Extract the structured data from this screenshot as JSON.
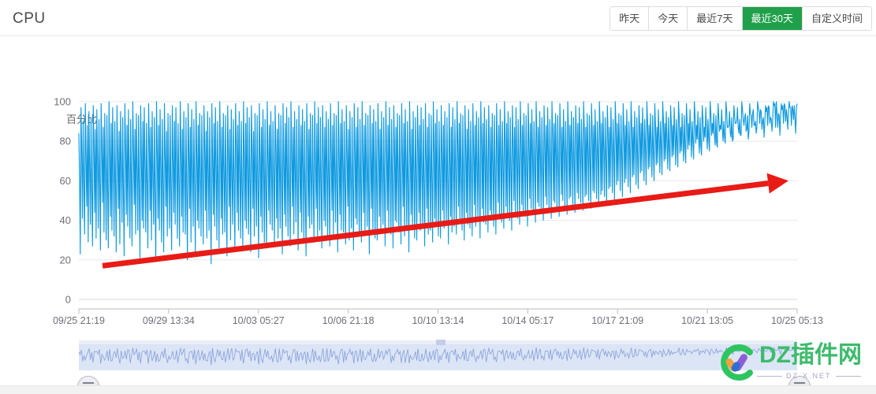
{
  "header": {
    "title": "CPU",
    "range_buttons": [
      {
        "label": "昨天",
        "active": false
      },
      {
        "label": "今天",
        "active": false
      },
      {
        "label": "最近7天",
        "active": false
      },
      {
        "label": "最近30天",
        "active": true
      },
      {
        "label": "自定义时间",
        "active": false
      }
    ]
  },
  "watermark": {
    "brand": "DZ插件网",
    "domain": "DZ-X.NET",
    "icon": "dz-logo-icon"
  },
  "slider": {
    "left_handle_icon": "slider-handle-icon",
    "right_handle_icon": "slider-handle-icon",
    "grip_icon": "slider-grip-icon"
  },
  "annotation": {
    "trend_arrow_color": "#e81b16",
    "trend_arrow_label": "upward-trend-arrow"
  },
  "colors": {
    "series": "#0f9ae0",
    "accent_green": "#20a04a",
    "grid": "#e8e8e8",
    "axis_text": "#6e7079",
    "slider_fill": "#d6e0f5",
    "slider_line": "#7e9ad8"
  },
  "chart_data": {
    "type": "line",
    "title": "CPU",
    "xlabel": "",
    "ylabel": "百分比",
    "ylim": [
      0,
      100
    ],
    "yticks": [
      0,
      20,
      40,
      60,
      80,
      100
    ],
    "grid": true,
    "legend": "none",
    "xticks": [
      "09/25 21:19",
      "09/29 13:34",
      "10/03 05:27",
      "10/06 21:18",
      "10/10 13:14",
      "10/14 05:17",
      "10/17 21:09",
      "10/21 13:05",
      "10/25 05:13"
    ],
    "series": [
      {
        "name": "CPU",
        "color": "#0f9ae0",
        "description": "Dense high-frequency CPU utilisation samples over 30 days, oscillating between roughly 5% and 100%, with a rising baseline over time.",
        "baseline_trend": {
          "start_pct": 17,
          "end_pct": 60
        },
        "values": [
          84,
          62,
          23,
          97,
          75,
          41,
          90,
          58,
          33,
          99,
          71,
          47,
          88,
          29,
          95,
          66,
          38,
          92,
          55,
          27,
          98,
          79,
          44,
          86,
          31,
          96,
          69,
          36,
          91,
          60,
          25,
          99,
          77,
          49,
          87,
          34,
          94,
          64,
          30,
          93,
          57,
          26,
          100,
          73,
          42,
          89,
          35,
          97,
          67,
          32,
          90,
          59,
          24,
          98,
          74,
          46,
          85,
          28,
          95,
          70,
          39,
          92,
          54,
          22,
          99,
          78,
          43,
          88,
          37,
          96,
          63,
          31,
          91,
          61,
          27,
          100,
          76,
          48,
          86,
          33,
          94,
          65,
          35,
          93,
          56,
          21,
          98,
          72,
          40,
          90,
          36,
          97,
          68,
          34,
          89,
          58,
          26,
          99,
          80,
          45,
          87,
          30,
          95,
          62,
          38,
          92,
          53,
          19,
          100,
          75,
          41,
          88,
          35,
          96,
          66,
          29,
          91,
          59,
          24,
          99,
          73,
          47,
          85,
          32,
          94,
          64,
          36,
          93,
          57,
          25,
          98,
          71,
          44,
          90,
          38,
          97,
          69,
          31,
          89,
          60,
          27,
          100,
          76,
          42,
          86,
          34,
          95,
          63,
          33,
          92,
          55,
          20,
          99,
          74,
          46,
          87,
          29,
          96,
          67,
          37,
          91,
          58,
          23,
          100,
          72,
          40,
          88,
          36,
          94,
          65,
          32,
          93,
          61,
          28,
          98,
          77,
          45,
          85,
          31,
          95,
          66,
          35,
          92,
          54,
          18,
          99,
          70,
          43,
          89,
          37,
          97,
          68,
          30,
          90,
          59,
          26,
          100,
          75,
          41,
          87,
          33,
          94,
          64,
          34,
          93,
          56,
          22,
          98,
          73,
          47,
          86,
          30,
          96,
          62,
          38,
          91,
          60,
          25,
          99,
          78,
          44,
          88,
          35,
          95,
          67,
          31,
          90,
          57,
          27,
          100,
          71,
          40,
          89,
          36,
          97,
          65,
          33,
          92,
          61,
          24,
          98,
          76,
          46,
          85,
          32,
          94,
          63,
          37,
          93,
          58,
          21,
          99,
          72,
          42,
          87,
          34,
          96,
          68,
          29,
          91,
          55,
          26,
          100,
          74,
          45,
          88,
          38,
          95,
          66,
          35,
          90,
          62,
          28,
          98,
          77,
          41,
          86,
          31,
          94,
          69,
          36,
          93,
          59,
          23,
          99,
          70,
          43,
          89,
          37,
          97,
          64,
          32,
          92,
          57,
          27,
          100,
          75,
          47,
          87,
          33,
          95,
          65,
          39,
          91,
          61,
          25,
          98,
          73,
          44,
          88,
          34,
          96,
          67,
          30,
          90,
          56,
          22,
          99,
          78,
          42,
          86,
          36,
          94,
          63,
          38,
          93,
          60,
          29,
          100,
          71,
          46,
          89,
          32,
          97,
          68,
          35,
          92,
          58,
          26,
          98,
          74,
          40,
          87,
          37,
          95,
          66,
          31,
          91,
          62,
          27,
          99,
          76,
          45,
          88,
          33,
          94,
          64,
          39,
          93,
          57,
          24,
          100,
          72,
          43,
          89,
          35,
          96,
          69,
          34,
          90,
          60,
          28,
          98,
          75,
          47,
          86,
          30,
          95,
          63,
          36,
          92,
          59,
          25,
          99,
          77,
          41,
          87,
          38,
          97,
          65,
          32,
          91,
          61,
          29,
          100,
          73,
          44,
          88,
          34,
          94,
          67,
          37,
          93,
          56,
          23,
          98,
          70,
          46,
          89,
          33,
          96,
          66,
          31,
          90,
          63,
          30,
          99,
          79,
          42,
          86,
          36,
          95,
          64,
          38,
          92,
          58,
          27,
          100,
          74,
          45,
          88,
          35,
          97,
          68,
          33,
          91,
          62,
          26,
          98,
          76,
          40,
          87,
          39,
          94,
          65,
          34,
          93,
          60,
          28,
          99,
          71,
          47,
          89,
          32,
          96,
          69,
          36,
          90,
          57,
          24,
          100,
          75,
          43,
          86,
          37,
          95,
          63,
          31,
          92,
          64,
          30,
          98,
          78,
          44,
          88,
          35,
          97,
          66,
          38,
          91,
          59,
          27,
          99,
          72,
          46,
          87,
          33,
          94,
          68,
          35,
          93,
          61,
          29,
          100,
          77,
          41,
          89,
          38,
          96,
          65,
          32,
          90,
          63,
          31,
          98,
          74,
          45,
          88,
          36,
          95,
          67,
          39,
          92,
          60,
          28,
          99,
          73,
          42,
          87,
          34,
          97,
          69,
          37,
          91,
          66,
          33,
          100,
          79,
          47,
          89,
          40,
          94,
          64,
          35,
          93,
          62,
          30,
          98,
          76,
          44,
          86,
          38,
          96,
          70,
          36,
          90,
          65,
          32,
          99,
          75,
          48,
          88,
          37,
          95,
          68,
          41,
          92,
          63,
          31,
          100,
          80,
          46,
          89,
          39,
          97,
          71,
          38,
          91,
          67,
          34,
          98,
          77,
          45,
          87,
          40,
          94,
          69,
          37,
          93,
          64,
          33,
          99,
          78,
          49,
          88,
          42,
          96,
          72,
          39,
          90,
          68,
          36,
          100,
          81,
          47,
          89,
          43,
          95,
          70,
          40,
          92,
          66,
          35,
          98,
          79,
          50,
          87,
          44,
          97,
          73,
          41,
          91,
          69,
          38,
          100,
          82,
          48,
          88,
          45,
          94,
          71,
          42,
          93,
          67,
          37,
          99,
          80,
          51,
          89,
          46,
          96,
          74,
          43,
          90,
          70,
          39,
          100,
          83,
          49,
          87,
          47,
          95,
          72,
          44,
          92,
          68,
          40,
          98,
          81,
          52,
          88,
          48,
          97,
          75,
          45,
          91,
          71,
          41,
          100,
          84,
          50,
          89,
          49,
          94,
          73,
          46,
          93,
          69,
          42,
          99,
          82,
          53,
          87,
          50,
          96,
          76,
          47,
          90,
          72,
          43,
          100,
          85,
          51,
          88,
          52,
          95,
          74,
          48,
          92,
          70,
          44,
          98,
          83,
          54,
          89,
          51,
          97,
          77,
          49,
          91,
          73,
          45,
          100,
          86,
          52,
          87,
          53,
          94,
          75,
          50,
          93,
          71,
          46,
          99,
          84,
          55,
          88,
          54,
          96,
          78,
          51,
          90,
          74,
          47,
          100,
          87,
          53,
          89,
          55,
          95,
          76,
          52,
          92,
          72,
          48,
          98,
          85,
          56,
          87,
          57,
          97,
          79,
          54,
          91,
          75,
          50,
          100,
          88,
          58,
          89,
          60,
          94,
          77,
          55,
          93,
          73,
          52,
          99,
          86,
          59,
          88,
          61,
          96,
          80,
          57,
          90,
          76,
          54,
          100,
          89,
          62,
          87,
          63,
          95,
          78,
          58,
          92,
          74,
          56,
          98,
          87,
          64,
          89,
          65,
          97,
          81,
          60,
          91,
          77,
          58,
          100,
          90,
          66,
          88,
          67,
          94,
          79,
          62,
          93,
          75,
          60,
          99,
          88,
          68,
          87,
          69,
          96,
          82,
          64,
          90,
          78,
          63,
          100,
          91,
          70,
          89,
          71,
          95,
          80,
          66,
          92,
          76,
          65,
          98,
          89,
          72,
          88,
          73,
          97,
          83,
          68,
          91,
          79,
          67,
          100,
          92,
          74,
          87,
          75,
          94,
          81,
          70,
          93,
          77,
          69,
          99,
          90,
          76,
          89,
          78,
          96,
          84,
          72,
          90,
          80,
          71,
          100,
          93,
          79,
          88,
          81,
          95,
          82,
          74,
          92,
          78,
          73,
          98,
          91,
          80,
          87,
          82,
          97,
          85,
          76,
          91,
          81,
          75,
          100,
          94,
          83,
          89,
          84,
          94,
          83,
          78,
          93,
          79,
          77,
          99,
          92,
          85,
          88,
          86,
          96,
          86,
          80,
          90,
          82,
          79,
          100,
          95,
          87,
          87,
          88,
          95,
          84,
          82,
          92,
          80,
          81,
          98,
          93,
          89,
          89,
          90,
          97,
          87,
          84,
          91,
          83,
          83,
          100,
          96,
          91,
          88,
          92,
          94,
          85,
          86,
          93,
          81,
          85,
          99,
          94,
          93,
          87,
          94,
          96,
          88,
          88,
          90,
          84,
          87,
          100,
          97,
          95,
          89,
          96,
          95,
          86,
          90,
          92,
          82,
          89,
          98,
          95,
          97,
          88,
          98,
          97,
          89,
          92,
          91,
          85,
          91,
          100,
          98,
          99,
          87,
          100,
          94,
          87,
          94,
          93,
          83,
          93,
          99,
          96,
          98,
          89,
          99,
          98,
          90,
          96,
          92,
          86,
          95,
          100,
          97,
          97,
          88,
          98,
          96,
          91,
          98,
          91,
          84,
          97,
          99
        ]
      }
    ]
  }
}
